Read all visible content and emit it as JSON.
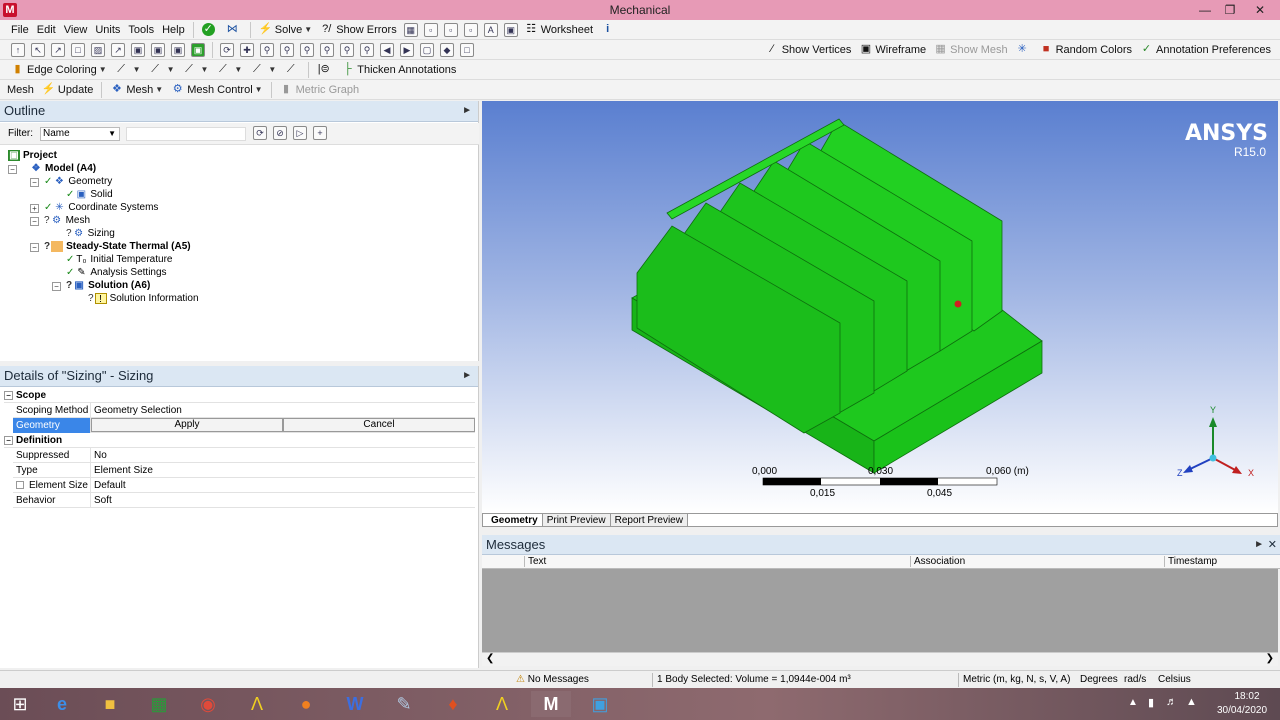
{
  "window": {
    "title": "Mechanical",
    "app_icon": "M"
  },
  "menu": [
    "File",
    "Edit",
    "View",
    "Units",
    "Tools",
    "Help"
  ],
  "toolbar1": {
    "solve": "Solve",
    "show_errors": "Show Errors",
    "worksheet": "Worksheet"
  },
  "toolbar2": {
    "show_vertices": "Show Vertices",
    "wireframe": "Wireframe",
    "show_mesh": "Show Mesh",
    "random_colors": "Random Colors",
    "annotation_preferences": "Annotation Preferences"
  },
  "toolbar3": {
    "edge_coloring": "Edge Coloring",
    "thicken_annotations": "Thicken Annotations"
  },
  "toolbar4": {
    "mesh_label": "Mesh",
    "update": "Update",
    "mesh": "Mesh",
    "mesh_control": "Mesh Control",
    "metric_graph": "Metric Graph"
  },
  "outline": {
    "title": "Outline",
    "filter_label": "Filter:",
    "filter_value": "Name",
    "tree": [
      {
        "label": "Project",
        "bold": true
      },
      {
        "label": "Model (A4)",
        "bold": true
      },
      {
        "label": "Geometry",
        "bold": false
      },
      {
        "label": "Solid",
        "bold": false
      },
      {
        "label": "Coordinate Systems",
        "bold": false
      },
      {
        "label": "Mesh",
        "bold": false
      },
      {
        "label": "Sizing",
        "bold": false
      },
      {
        "label": "Steady-State Thermal (A5)",
        "bold": true
      },
      {
        "label": "Initial Temperature",
        "bold": false
      },
      {
        "label": "Analysis Settings",
        "bold": false
      },
      {
        "label": "Solution (A6)",
        "bold": true
      },
      {
        "label": "Solution Information",
        "bold": false
      }
    ]
  },
  "details": {
    "title": "Details of \"Sizing\" - Sizing",
    "scope_section": "Scope",
    "scoping_method_key": "Scoping Method",
    "scoping_method_val": "Geometry Selection",
    "geometry_key": "Geometry",
    "apply": "Apply",
    "cancel": "Cancel",
    "definition_section": "Definition",
    "suppressed_key": "Suppressed",
    "suppressed_val": "No",
    "type_key": "Type",
    "type_val": "Element Size",
    "element_size_key": "Element Size",
    "element_size_val": "Default",
    "behavior_key": "Behavior",
    "behavior_val": "Soft"
  },
  "viewport": {
    "brand": "ANSYS",
    "version": "R15.0",
    "scale_top": [
      "0,000",
      "0,030",
      "0,060 (m)"
    ],
    "scale_bottom": [
      "0,015",
      "0,045"
    ],
    "axis_x": "X",
    "axis_y": "Y",
    "axis_z": "Z",
    "model_color": "#1ec81e"
  },
  "view_tabs": [
    "Geometry",
    "Print Preview",
    "Report Preview"
  ],
  "messages": {
    "title": "Messages",
    "col_text": "Text",
    "col_association": "Association",
    "col_timestamp": "Timestamp"
  },
  "status": {
    "messages": "No Messages",
    "selection": "1 Body Selected: Volume = 1,0944e-004 m³",
    "units": "Metric (m, kg, N, s, V, A)",
    "angle": "Degrees",
    "rot": "rad/s",
    "temp": "Celsius"
  },
  "taskbar": {
    "time": "18:02",
    "date": "30/04/2020"
  }
}
